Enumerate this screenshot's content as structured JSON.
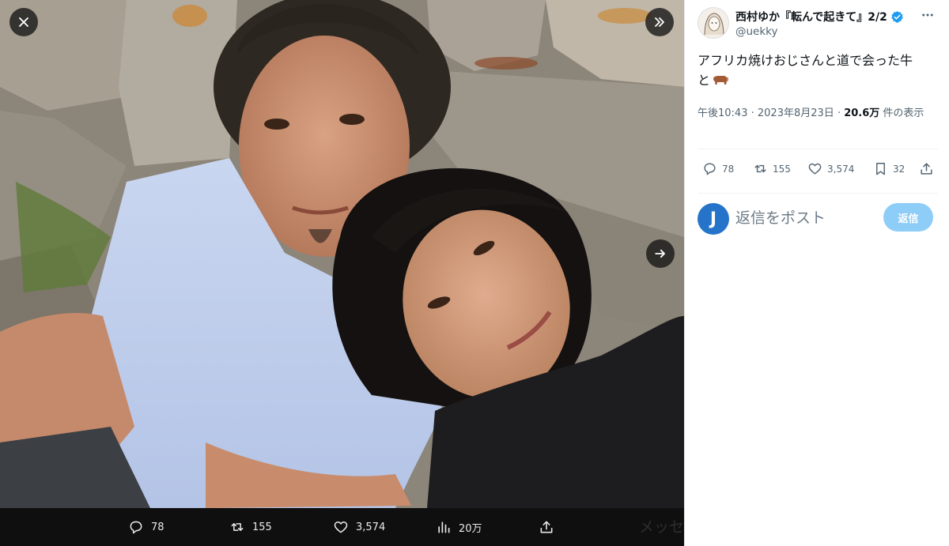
{
  "viewer": {
    "close_icon": "close-icon",
    "expand_icon": "double-chevron-right-icon",
    "next_icon": "arrow-right-icon",
    "actions": {
      "replies": "78",
      "retweets": "155",
      "likes": "3,574",
      "views": "20万"
    },
    "ghost_text": "メッセ"
  },
  "tweet": {
    "display_name": "西村ゆか『転んで起きて』2/2",
    "handle": "@uekky",
    "text_line1": "アフリカ焼けおじさんと道で会った牛",
    "text_line2": "と",
    "time": "午後10:43",
    "separator": "·",
    "date": "2023年8月23日",
    "views_count": "20.6万",
    "views_label": " 件の表示",
    "stats": {
      "replies": "78",
      "retweets": "155",
      "likes": "3,574",
      "bookmarks": "32"
    }
  },
  "reply": {
    "avatar_letter": "J",
    "placeholder": "返信をポスト",
    "button_label": "返信"
  },
  "colors": {
    "accent": "#1d9bf0",
    "reply_button": "#8ecdf8",
    "verified": "#1d9bf0",
    "text_secondary": "#536471"
  }
}
